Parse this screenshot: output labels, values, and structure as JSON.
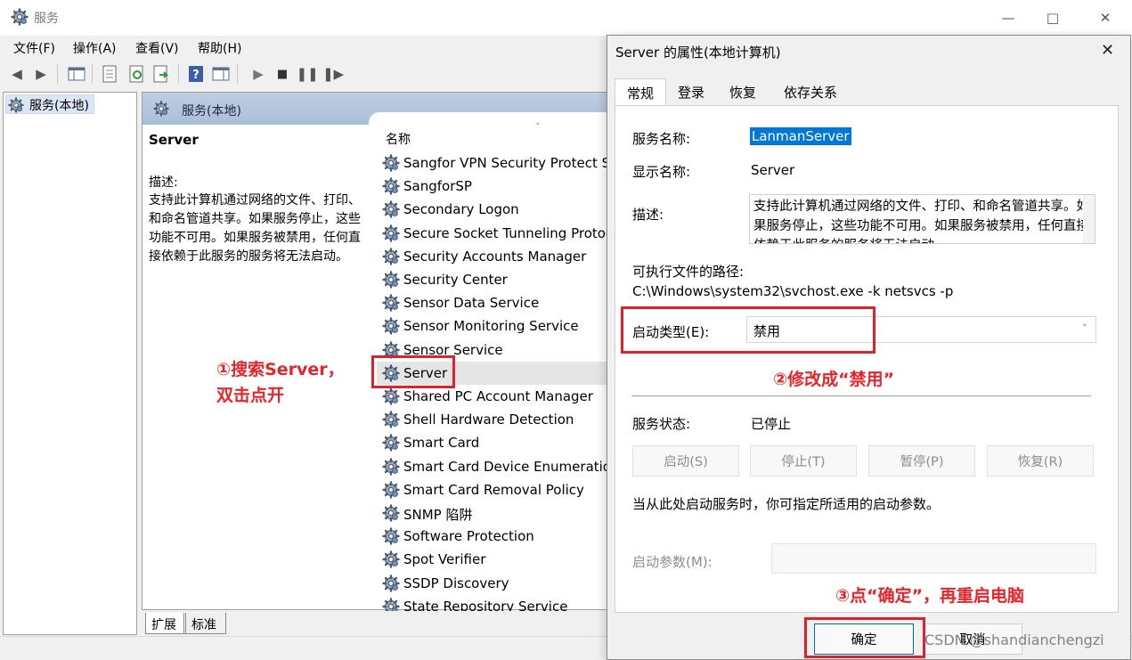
{
  "window": {
    "title": "服务",
    "minimize_icon": "minimize-icon",
    "maximize_icon": "maximize-icon",
    "close_icon": "close-icon"
  },
  "menu": [
    "文件(F)",
    "操作(A)",
    "查看(V)",
    "帮助(H)"
  ],
  "tree": {
    "root_label": "服务(本地)"
  },
  "pane": {
    "header": "服务(本地)",
    "selected_service": "Server",
    "description_label": "描述:",
    "description": "支持此计算机通过网络的文件、打印、和命名管道共享。如果服务停止，这些功能不可用。如果服务被禁用，任何直接依赖于此服务的服务将无法启动。",
    "column_name": "名称",
    "services": [
      "Sangfor VPN Security Protect Service",
      "SangforSP",
      "Secondary Logon",
      "Secure Socket Tunneling Protocol Service",
      "Security Accounts Manager",
      "Security Center",
      "Sensor Data Service",
      "Sensor Monitoring Service",
      "Sensor Service",
      "Server",
      "Shared PC Account Manager",
      "Shell Hardware Detection",
      "Smart Card",
      "Smart Card Device Enumeration Service",
      "Smart Card Removal Policy",
      "SNMP 陷阱",
      "Software Protection",
      "Spot Verifier",
      "SSDP Discovery",
      "State Repository Service"
    ],
    "tabs": [
      "扩展",
      "标准"
    ]
  },
  "annotations": {
    "step1_line1": "①搜索Server，",
    "step1_line2": "双击点开",
    "step2": "②修改成“禁用”",
    "step3": "③点“确定”，再重启电脑",
    "color": "#e8232a"
  },
  "dialog": {
    "title": "Server 的属性(本地计算机)",
    "tabs": [
      "常规",
      "登录",
      "恢复",
      "依存关系"
    ],
    "service_name_label": "服务名称:",
    "service_name": "LanmanServer",
    "display_name_label": "显示名称:",
    "display_name": "Server",
    "description_label": "描述:",
    "description": "支持此计算机通过网络的文件、打印、和命名管道共享。如果服务停止，这些功能不可用。如果服务被禁用，任何直接依赖于此服务的服务将无法启动。",
    "path_label": "可执行文件的路径:",
    "path": "C:\\Windows\\system32\\svchost.exe -k netsvcs -p",
    "startup_type_label": "启动类型(E):",
    "startup_type": "禁用",
    "status_label": "服务状态:",
    "status": "已停止",
    "buttons": [
      "启动(S)",
      "停止(T)",
      "暂停(P)",
      "恢复(R)"
    ],
    "hint": "当从此处启动服务时，你可指定所适用的启动参数。",
    "params_label": "启动参数(M):",
    "ok": "确定",
    "cancel": "取消"
  },
  "watermark": "CSDN @shandianchengzi"
}
